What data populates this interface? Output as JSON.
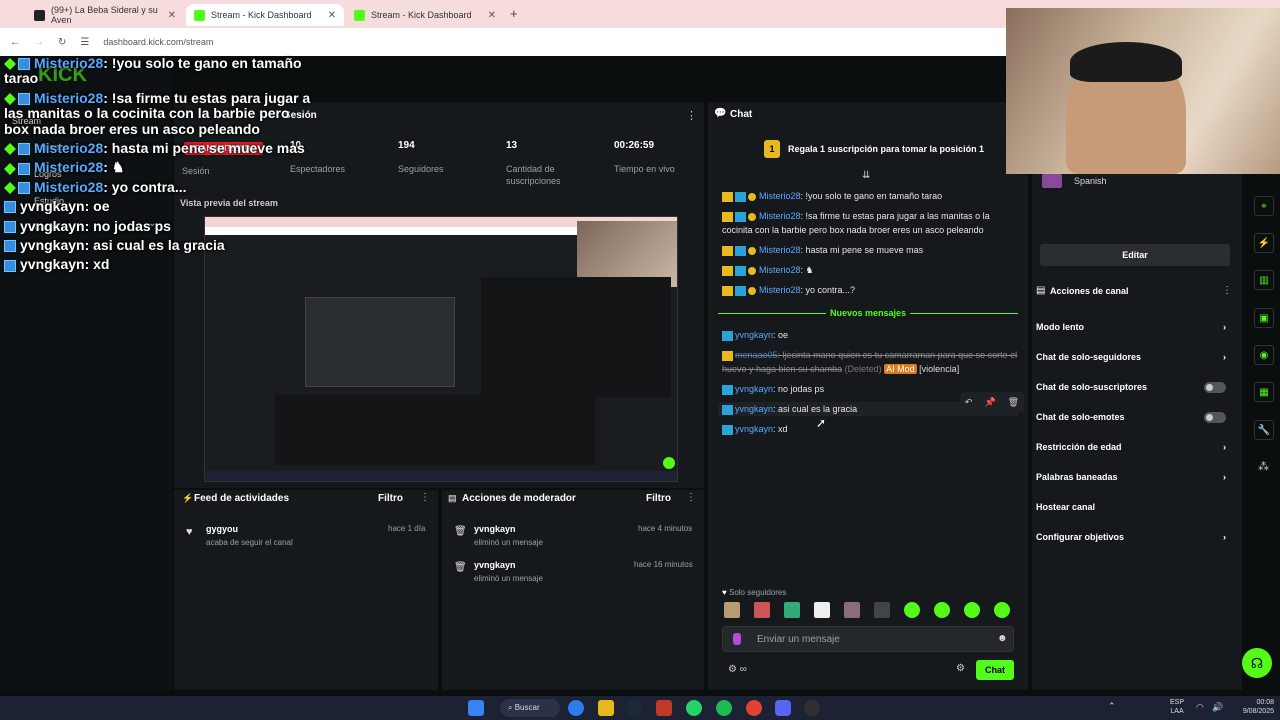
{
  "browser": {
    "tabs": [
      {
        "label": "(99+) La Beba Sideral y su Aven"
      },
      {
        "label": "Stream - Kick Dashboard"
      },
      {
        "label": "Stream - Kick Dashboard"
      }
    ],
    "url": "dashboard.kick.com/stream"
  },
  "overlay_chat": [
    {
      "user": "Misterio28",
      "text": ": !you solo te gano en tamaño tarao"
    },
    {
      "user": "Misterio28",
      "text": ": !sa firme tu estas para jugar a las manitas o la cocinita con la barbie pero box nada broer eres un asco peleando"
    },
    {
      "user": "Misterio28",
      "text": ": hasta mi pene se mueve mas"
    },
    {
      "user": "Misterio28",
      "text": ":"
    },
    {
      "user": "Misterio28",
      "text": ": yo contra..."
    },
    {
      "user": "yvngkayn",
      "text": ": oe"
    },
    {
      "user": "yvngkayn",
      "text": ": no jodas ps"
    },
    {
      "user": "yvngkayn",
      "text": ": asi cual es la gracia"
    },
    {
      "user": "yvngkayn",
      "text": ": xd"
    }
  ],
  "sidebar": {
    "items": [
      "Stream",
      "Ingresos",
      "Logros",
      "Estudio",
      "Canal"
    ]
  },
  "session": {
    "title": "Sesión",
    "live_badge": "TRANSMITIENDO",
    "label": "Sesión",
    "stats": [
      {
        "value": "10",
        "label": "Espectadores"
      },
      {
        "value": "194",
        "label": "Seguidores"
      },
      {
        "value": "13",
        "label": "Cantidad de suscripciones"
      },
      {
        "value": "00:26:59",
        "label": "Tiempo en vivo"
      }
    ],
    "preview_label": "Vista previa del stream"
  },
  "activity_feed": {
    "title": "Feed de actividades",
    "filter": "Filtro",
    "items": [
      {
        "user": "gygyou",
        "text": "acaba de seguir el canal",
        "time": "hace 1 día"
      }
    ]
  },
  "mod_actions": {
    "title": "Acciones de moderador",
    "filter": "Filtro",
    "items": [
      {
        "user": "yvngkayn",
        "text": "eliminó un mensaje",
        "time": "hace 4 minutos"
      },
      {
        "user": "yvngkayn",
        "text": "eliminó un mensaje",
        "time": "hace 16 minutos"
      }
    ]
  },
  "chat": {
    "title": "Chat",
    "gift_banner": "Regala 1 suscripción para tomar la posición 1",
    "gift_rank": "1",
    "messages": [
      {
        "user": "Misterio28",
        "text": ": !you solo te gano en tamaño tarao"
      },
      {
        "user": "Misterio28",
        "text": ": !sa firme tu estas para jugar a las manitas o la cocinita con la barbie pero box nada broer eres un asco peleando"
      },
      {
        "user": "Misterio28",
        "text": ": hasta mi pene se mueve mas"
      },
      {
        "user": "Misterio28",
        "text": ":"
      },
      {
        "user": "Misterio28",
        "text": ": yo contra...?"
      }
    ],
    "new_messages_label": "Nuevos mensajes",
    "messages_new": [
      {
        "user": "yvngkayn",
        "text": ": oe"
      },
      {
        "user": "yvngkayn",
        "text": ": asi cual es la gracia"
      },
      {
        "user": "yvngkayn",
        "text": ": xd"
      }
    ],
    "deleted": {
      "user": "menaao05",
      "text": ": ljecinta mano quien es tu camarraman para que se corte el huevo y haga bien su chamba",
      "deleted_tag": "(Deleted)",
      "ai_tag": "AI Mod",
      "reason": "[violencia]"
    },
    "msg_nojodas": {
      "user": "yvngkayn",
      "text": ": no jodas ps"
    },
    "followers_only": "Solo seguidores",
    "input_placeholder": "Enviar un mensaje",
    "send_label": "Chat"
  },
  "right_panel": {
    "language": "Spanish",
    "edit_label": "Editar",
    "actions_title": "Acciones de canal",
    "actions": [
      {
        "label": "Modo lento",
        "control": "chevron"
      },
      {
        "label": "Chat de solo-seguidores",
        "control": "chevron"
      },
      {
        "label": "Chat de solo-suscriptores",
        "control": "toggle"
      },
      {
        "label": "Chat de solo-emotes",
        "control": "toggle"
      },
      {
        "label": "Restricción de edad",
        "control": "chevron"
      },
      {
        "label": "Palabras baneadas",
        "control": "chevron"
      },
      {
        "label": "Hostear canal",
        "control": "none"
      },
      {
        "label": "Configurar objetivos",
        "control": "chevron"
      }
    ]
  },
  "taskbar": {
    "search_label": "Buscar",
    "lang": "ESP",
    "lang2": "LAA",
    "time": "00:08",
    "date": "9/08/2025"
  },
  "colors": {
    "accent": "#53fc18",
    "bg": "#0b0e0f",
    "panel": "#16191c"
  }
}
